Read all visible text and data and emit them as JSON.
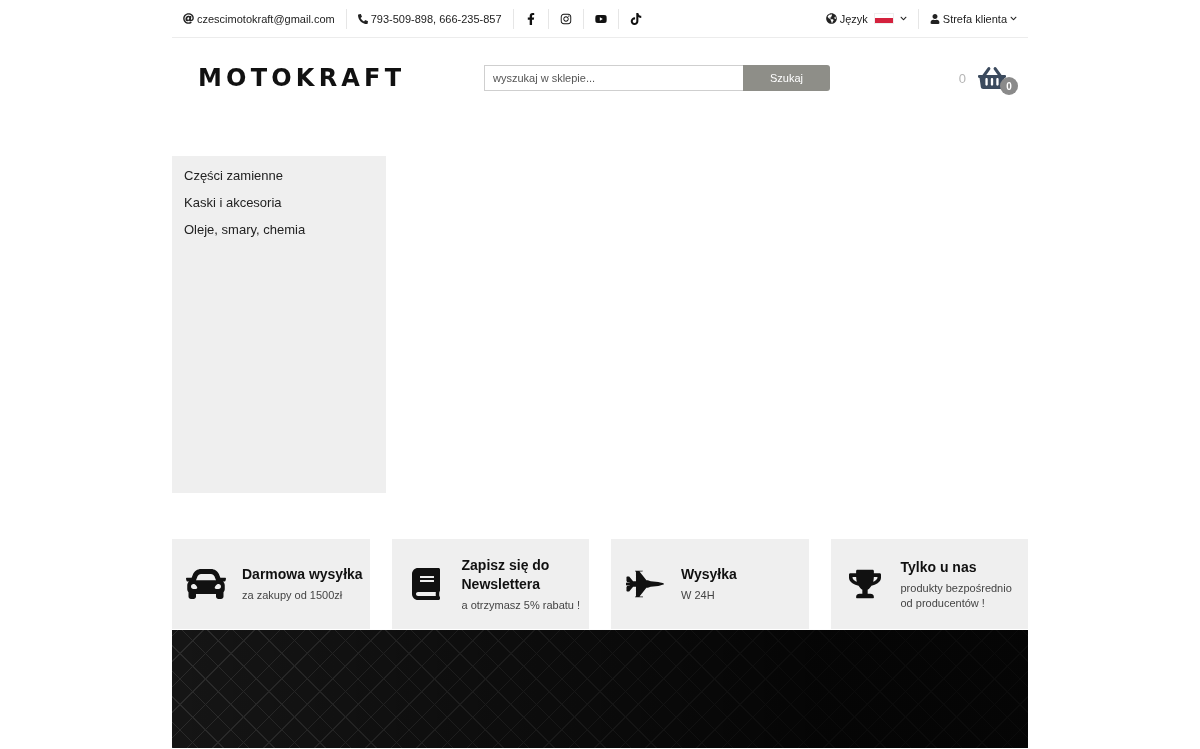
{
  "top_bar": {
    "email": "czescimotokraft@gmail.com",
    "phone": "793-509-898, 666-235-857",
    "social": [
      {
        "kind": "facebook"
      },
      {
        "kind": "instagram"
      },
      {
        "kind": "youtube"
      },
      {
        "kind": "tiktok"
      }
    ],
    "language": {
      "label": "Język"
    },
    "account": {
      "label": "Strefa klienta"
    }
  },
  "header": {
    "logo": "MOTOKRAFT",
    "search": {
      "placeholder": "wyszukaj w sklepie...",
      "button": "Szukaj"
    },
    "cart": {
      "total": "0",
      "count": "0"
    }
  },
  "sidebar": {
    "items": [
      "Części zamienne",
      "Kaski i akcesoria",
      "Oleje, smary, chemia"
    ]
  },
  "features": [
    {
      "kind": "car",
      "title": "Darmowa wysyłka",
      "subtitle": "za zakupy od 1500zł"
    },
    {
      "kind": "book",
      "title": "Zapisz się do Newslettera",
      "subtitle": "a otrzymasz 5% rabatu !"
    },
    {
      "kind": "jet",
      "title": "Wysyłka",
      "subtitle": "W 24H"
    },
    {
      "kind": "trophy",
      "title": "Tylko u nas",
      "subtitle": "produkty bezpośrednio od producentów !"
    }
  ]
}
